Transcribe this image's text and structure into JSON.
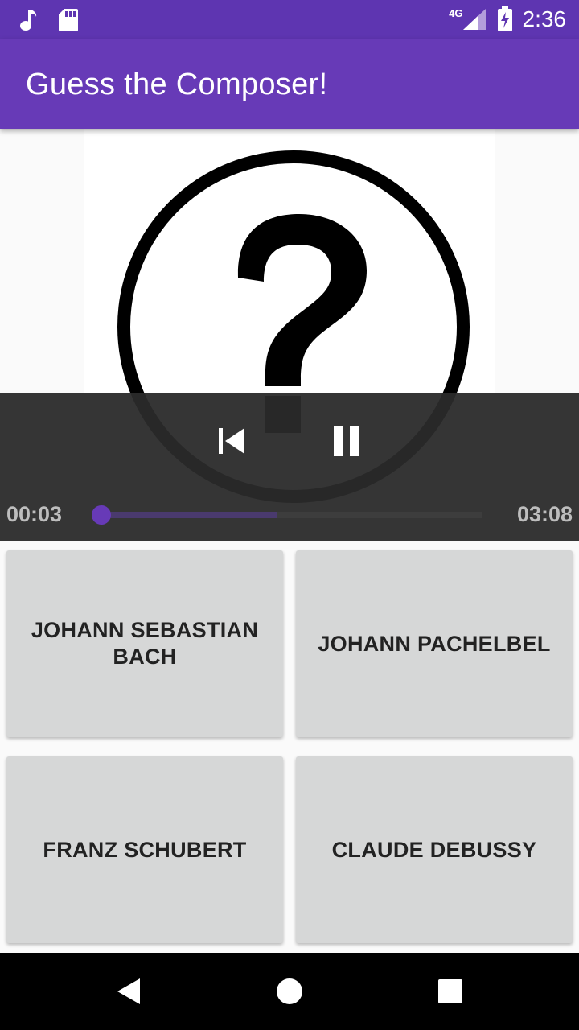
{
  "status_bar": {
    "time": "2:36",
    "network": "4G",
    "icons": [
      "music-note-icon",
      "sd-card-icon",
      "signal-icon",
      "battery-charging-icon"
    ]
  },
  "app_bar": {
    "title": "Guess the Composer!"
  },
  "player": {
    "artwork": "question-mark-icon",
    "current_time": "00:03",
    "duration": "03:08",
    "progress": 0.0,
    "buffered": 0.46,
    "controls": [
      "previous-icon",
      "pause-icon"
    ]
  },
  "answers": [
    {
      "label": "JOHANN SEBASTIAN BACH"
    },
    {
      "label": "JOHANN PACHELBEL"
    },
    {
      "label": "FRANZ SCHUBERT"
    },
    {
      "label": "CLAUDE DEBUSSY"
    }
  ],
  "nav_bar": {
    "buttons": [
      "back-icon",
      "home-icon",
      "recents-icon"
    ]
  },
  "colors": {
    "status_bar": "#5e35b1",
    "primary": "#673ab7",
    "button_bg": "#d6d7d7",
    "controls_bg": "#2a2a2a"
  }
}
